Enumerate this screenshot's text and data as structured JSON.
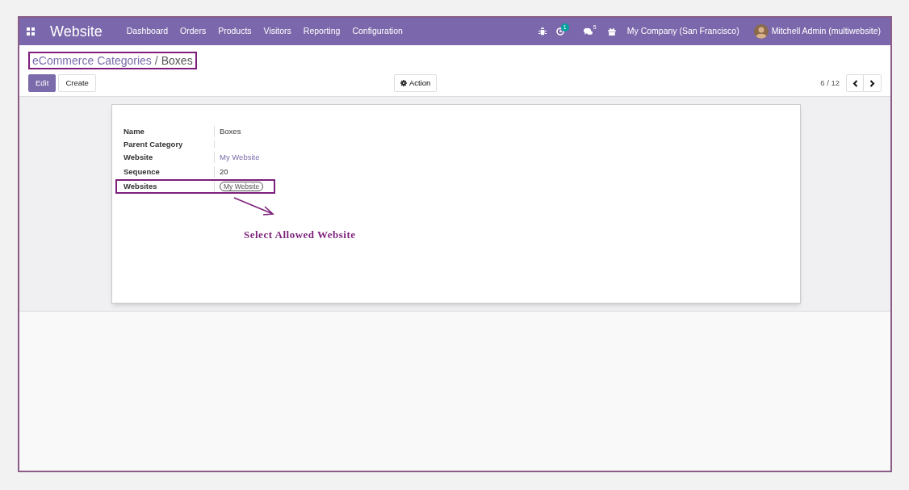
{
  "navbar": {
    "app_name": "Website",
    "menu": [
      {
        "label": "Dashboard"
      },
      {
        "label": "Orders"
      },
      {
        "label": "Products"
      },
      {
        "label": "Visitors"
      },
      {
        "label": "Reporting"
      },
      {
        "label": "Configuration"
      }
    ],
    "activity_count": "1",
    "message_count": "5",
    "company": "My Company (San Francisco)",
    "user": "Mitchell Admin (multiwebsite)"
  },
  "breadcrumb": {
    "parent": "eCommerce Categories",
    "separator": "/",
    "current": "Boxes",
    "highlighted": true
  },
  "buttons": [
    {
      "label": "Edit",
      "kind": "primary"
    },
    {
      "label": "Create",
      "kind": "secondary"
    }
  ],
  "action_button": "Action",
  "pager": {
    "text": "6 / 12"
  },
  "fields": [
    {
      "label": "Name",
      "kind": "text",
      "value": "Boxes",
      "highlighted": false
    },
    {
      "label": "Parent Category",
      "kind": "empty",
      "highlighted": false
    },
    {
      "label": "Website",
      "kind": "link",
      "value": "My Website",
      "highlighted": false
    },
    {
      "label": "Sequence",
      "kind": "text",
      "value": "20",
      "highlighted": false
    },
    {
      "label": "Websites",
      "kind": "tag",
      "value": "My Website",
      "highlighted": true
    }
  ],
  "annotation": {
    "caption": "Select Allowed Website"
  }
}
